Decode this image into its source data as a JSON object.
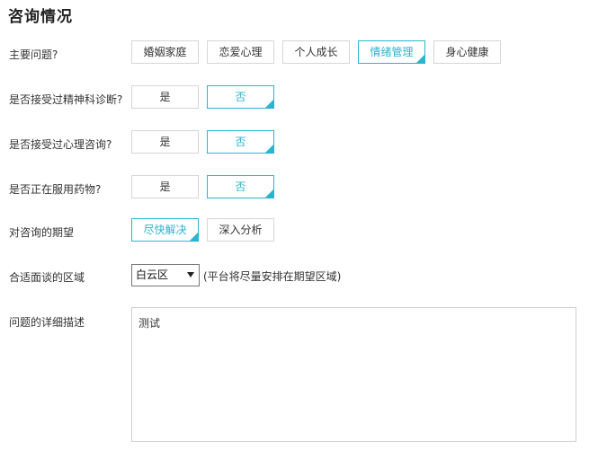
{
  "page": {
    "title": "咨询情况"
  },
  "rows": [
    {
      "label": "主要问题?",
      "options": [
        "婚姻家庭",
        "恋爱心理",
        "个人成长",
        "情绪管理",
        "身心健康"
      ],
      "selected": "情绪管理"
    },
    {
      "label": "是否接受过精神科诊断?",
      "options": [
        "是",
        "否"
      ],
      "selected": "否"
    },
    {
      "label": "是否接受过心理咨询?",
      "options": [
        "是",
        "否"
      ],
      "selected": "否"
    },
    {
      "label": "是否正在服用药物?",
      "options": [
        "是",
        "否"
      ],
      "selected": "否"
    },
    {
      "label": "对咨询的期望",
      "options": [
        "尽快解决",
        "深入分析"
      ],
      "selected": "尽快解决"
    }
  ],
  "area": {
    "label": "合适面谈的区域",
    "selected": "白云区",
    "note": "(平台将尽量安排在期望区域)"
  },
  "description": {
    "label": "问题的详细描述",
    "value": "测试"
  },
  "colors": {
    "accent": "#2bb4cf",
    "border": "#d6d6d6"
  }
}
